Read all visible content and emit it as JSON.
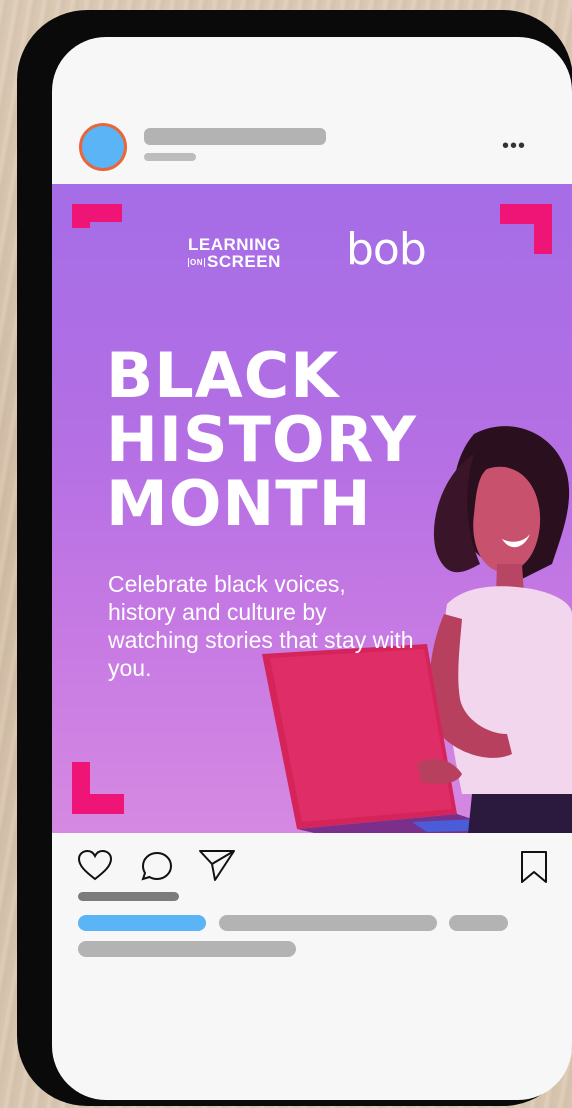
{
  "post": {
    "header": {
      "more_label": "•••"
    },
    "image": {
      "logo_line1": "LEARNING",
      "logo_on": "ON",
      "logo_line2": "SCREEN",
      "brand": "bob",
      "headline": [
        "BLACK",
        "HISTORY",
        "MONTH"
      ],
      "tagline": "Celebrate black voices, history and culture by watching stories that stay with you.",
      "accent_color": "#ee1577",
      "background_color": "#b06ee4"
    },
    "actions": {
      "like_icon": "heart-icon",
      "comment_icon": "comment-icon",
      "share_icon": "send-icon",
      "save_icon": "bookmark-icon"
    }
  },
  "colors": {
    "avatar_fill": "#5ab4f5",
    "avatar_ring": "#e8663a",
    "link_placeholder": "#5ab4f5",
    "placeholder_grey": "#b3b3b3"
  }
}
